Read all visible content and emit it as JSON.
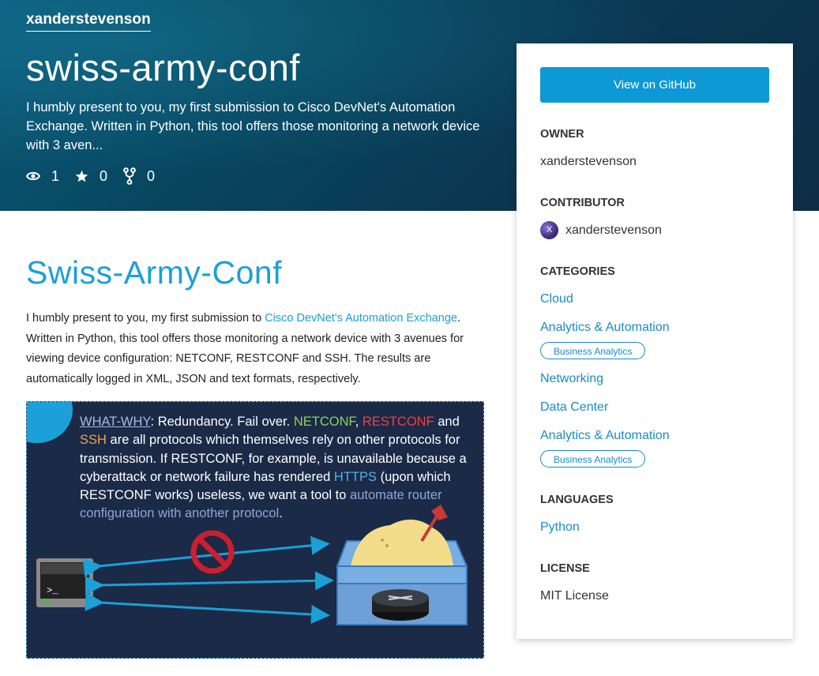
{
  "header": {
    "owner": "xanderstevenson",
    "title": "swiss-army-conf",
    "description": "I humbly present to you, my first submission to Cisco DevNet's Automation Exchange. Written in Python, this tool offers those monitoring a network device with 3 aven...",
    "stats": {
      "watchers": "1",
      "stars": "0",
      "forks": "0"
    }
  },
  "readme": {
    "heading": "Swiss-Army-Conf",
    "intro_before": "I humbly present to you, my first submission to ",
    "intro_link": "Cisco DevNet's Automation Exchange",
    "intro_after": ". Written in Python, this tool offers those monitoring a network device with 3 avenues for viewing device configuration: NETCONF, RESTCONF and SSH. The results are automatically logged in XML, JSON and text formats, respectively."
  },
  "diagram": {
    "what_why": "WHAT-WHY",
    "t1": ": Redundancy. Fail over. ",
    "netconf": "NETCONF",
    "comma": ", ",
    "restconf": "RESTCONF",
    "and": " and",
    "ssh": "SSH",
    "t2": " are all protocols which themselves rely on other protocols for transmission. If RESTCONF, for example, is unavailable because a cyberattack or network failure has rendered ",
    "https": "HTTPS",
    "t3": " (upon which RESTCONF works) useless, we want a tool to ",
    "automate": "automate router configuration with another protocol",
    "period": ".",
    "terminal_prompt": ">_"
  },
  "sidebar": {
    "github_button": "View on GitHub",
    "owner_label": "OWNER",
    "owner_value": "xanderstevenson",
    "contributor_label": "CONTRIBUTOR",
    "contributor_initial": "X",
    "contributor_name": "xanderstevenson",
    "categories_label": "CATEGORIES",
    "categories": [
      "Cloud",
      "Analytics & Automation",
      "Business Analytics",
      "Networking",
      "Data Center",
      "Analytics & Automation",
      "Business Analytics"
    ],
    "languages_label": "LANGUAGES",
    "language": "Python",
    "license_label": "LICENSE",
    "license": "MIT License"
  },
  "colors": {
    "accent": "#1ba0d7",
    "button": "#0d98d6",
    "header_bg": "#08465f"
  },
  "icons": [
    "eye-icon",
    "star-icon",
    "fork-icon",
    "terminal-icon",
    "no-entry-icon",
    "router-icon",
    "sandbox-icon"
  ]
}
